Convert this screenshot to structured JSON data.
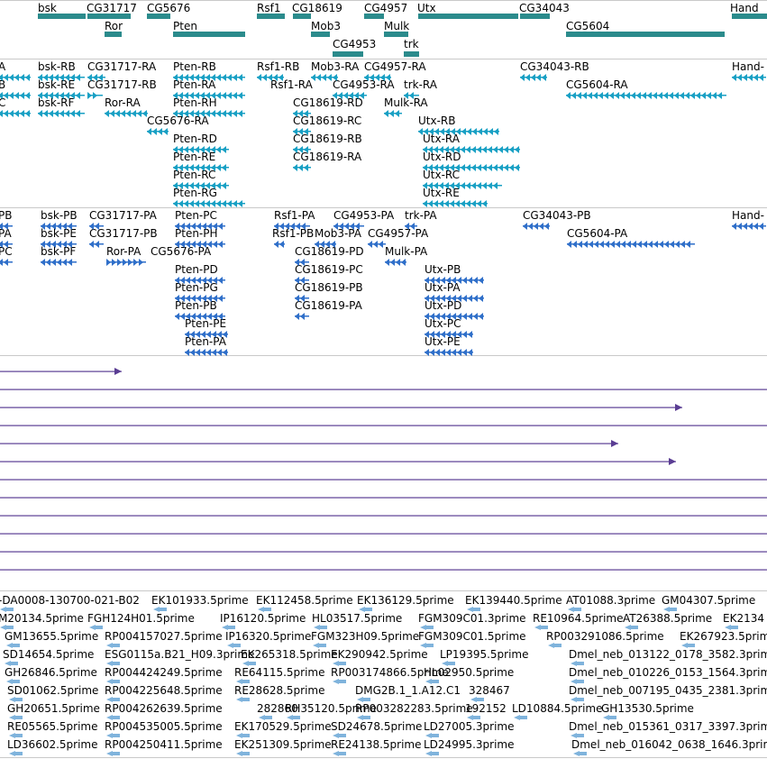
{
  "colors": {
    "gene_bar": "#2b8b8c",
    "transcript": "#19a0c4",
    "protein": "#2f6fc9",
    "blast_line": "#5a3d93",
    "est": "#7fb3dc",
    "separator": "#c9c9c9"
  },
  "gene_track": {
    "features": [
      {
        "label": "bsk"
      },
      {
        "label": "CG31717"
      },
      {
        "label": "CG5676"
      },
      {
        "label": "Rsf1"
      },
      {
        "label": "CG18619"
      },
      {
        "label": "CG4957"
      },
      {
        "label": "Utx"
      },
      {
        "label": "CG34043"
      },
      {
        "label": "Hand"
      },
      {
        "label": "Ror"
      },
      {
        "label": "Pten"
      },
      {
        "label": "Mob3"
      },
      {
        "label": "Mulk"
      },
      {
        "label": "CG5604"
      },
      {
        "label": "CG4953"
      },
      {
        "label": "trk"
      }
    ]
  },
  "transcript_track": {
    "features": [
      {
        "label": "A"
      },
      {
        "label": "B"
      },
      {
        "label": "C"
      },
      {
        "label": "bsk-RB"
      },
      {
        "label": "bsk-RE"
      },
      {
        "label": "bsk-RF"
      },
      {
        "label": "CG31717-RA"
      },
      {
        "label": "CG31717-RB"
      },
      {
        "label": "Ror-RA"
      },
      {
        "label": "CG5676-RA"
      },
      {
        "label": "Pten-RB"
      },
      {
        "label": "Pten-RA"
      },
      {
        "label": "Pten-RH"
      },
      {
        "label": "Pten-RD"
      },
      {
        "label": "Pten-RE"
      },
      {
        "label": "Pten-RC"
      },
      {
        "label": "Pten-RG"
      },
      {
        "label": "Rsf1-RB"
      },
      {
        "label": "Rsf1-RA"
      },
      {
        "label": "Mob3-RA"
      },
      {
        "label": "CG4957-RA"
      },
      {
        "label": "CG4953-RA"
      },
      {
        "label": "trk-RA"
      },
      {
        "label": "CG18619-RD"
      },
      {
        "label": "CG18619-RC"
      },
      {
        "label": "CG18619-RB"
      },
      {
        "label": "CG18619-RA"
      },
      {
        "label": "Mulk-RA"
      },
      {
        "label": "Utx-RB"
      },
      {
        "label": "Utx-RA"
      },
      {
        "label": "Utx-RD"
      },
      {
        "label": "Utx-RC"
      },
      {
        "label": "Utx-RE"
      },
      {
        "label": "CG34043-RB"
      },
      {
        "label": "CG5604-RA"
      },
      {
        "label": "Hand-"
      }
    ]
  },
  "protein_track": {
    "features": [
      {
        "label": "PB"
      },
      {
        "label": "PA"
      },
      {
        "label": "PC"
      },
      {
        "label": "bsk-PB"
      },
      {
        "label": "bsk-PE"
      },
      {
        "label": "bsk-PF"
      },
      {
        "label": "CG31717-PA"
      },
      {
        "label": "CG31717-PB"
      },
      {
        "label": "Ror-PA"
      },
      {
        "label": "CG5676-PA"
      },
      {
        "label": "Pten-PC"
      },
      {
        "label": "Pten-PH"
      },
      {
        "label": "Pten-PD"
      },
      {
        "label": "Pten-PG"
      },
      {
        "label": "Pten-PB"
      },
      {
        "label": "Pten-PE"
      },
      {
        "label": "Pten-PA"
      },
      {
        "label": "Rsf1-PA"
      },
      {
        "label": "Rsf1-PB"
      },
      {
        "label": "Mob3-PA"
      },
      {
        "label": "CG4953-PA"
      },
      {
        "label": "CG4957-PA"
      },
      {
        "label": "trk-PA"
      },
      {
        "label": "Mulk-PA"
      },
      {
        "label": "CG18619-PD"
      },
      {
        "label": "CG18619-PC"
      },
      {
        "label": "CG18619-PB"
      },
      {
        "label": "CG18619-PA"
      },
      {
        "label": "Utx-PB"
      },
      {
        "label": "Utx-PA"
      },
      {
        "label": "Utx-PD"
      },
      {
        "label": "Utx-PC"
      },
      {
        "label": "Utx-PE"
      },
      {
        "label": "CG34043-PB"
      },
      {
        "label": "CG5604-PA"
      },
      {
        "label": "Hand-"
      }
    ]
  },
  "est_track": {
    "rows": [
      [
        "-DA0008-130700-021-B02",
        "EK101933.5prime",
        "EK112458.5prime",
        "EK136129.5prime",
        "EK139440.5prime",
        "AT01088.3prime",
        "GM04307.5prime"
      ],
      [
        "M20134.5prime",
        "FGH124H01.5prime",
        "IP16120.5prime",
        "HL03517.5prime",
        "FGM309C01.3prime",
        "RE10964.5prime",
        "AT26388.5prime",
        "EK2134"
      ],
      [
        "GM13655.5prime",
        "RP004157027.5prime",
        "IP16320.5prime",
        "FGM323H09.5prime",
        "FGM309C01.5prime",
        "RP003291086.5prime",
        "EK267923.5prime"
      ],
      [
        "SD14654.5prime",
        "ESG0115a.B21_H09.3prime",
        "EK265318.5prime",
        "EK290942.5prime",
        "LP19395.5prime",
        "Dmel_neb_013122_0178_3582.3prime"
      ],
      [
        "GH26846.5prime",
        "RP004424249.5prime",
        "RE64115.5prime",
        "RP003174866.5prime",
        "HL02950.5prime",
        "Dmel_neb_010226_0153_1564.3prime"
      ],
      [
        "SD01062.5prime",
        "RP004225648.5prime",
        "RE28628.5prime",
        "DMG2B.1_1.A12.C1",
        "328467",
        "Dmel_neb_007195_0435_2381.3prime"
      ],
      [
        "GH20651.5prime",
        "RP004262639.5prime",
        "282860",
        "RH35120.5prime",
        "RP003282283.5prime",
        "192152",
        "LD10884.5prime",
        "GH13530.5prime"
      ],
      [
        "RE05565.5prime",
        "RP004535005.5prime",
        "EK170529.5prime",
        "SD24678.5prime",
        "LD27005.3prime",
        "Dmel_neb_015361_0317_3397.3prime"
      ],
      [
        "LD36602.5prime",
        "RP004250411.5prime",
        "EK251309.5prime",
        "RE24138.5prime",
        "LD24995.3prime",
        "Dmel_neb_016042_0638_1646.3prime"
      ]
    ]
  }
}
